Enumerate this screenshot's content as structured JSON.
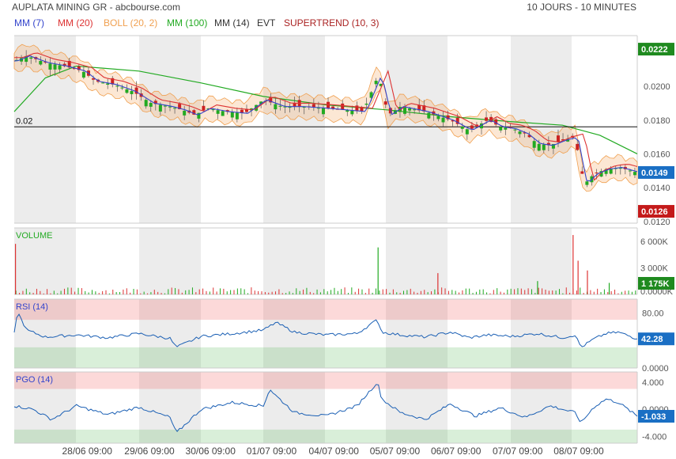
{
  "header": {
    "title": "AUPLATA MINING GR - abcbourse.com",
    "period": "10 JOURS - 10 MINUTES"
  },
  "legend": [
    {
      "label": "MM (7)",
      "color": "#3344cc"
    },
    {
      "label": "MM (20)",
      "color": "#dd3333"
    },
    {
      "label": "BOLL (20, 2)",
      "color": "#f0a050"
    },
    {
      "label": "MM (100)",
      "color": "#22aa22"
    },
    {
      "label": "MM (14)",
      "color": "#333333"
    },
    {
      "label": "EVT",
      "color": "#333333"
    },
    {
      "label": "SUPERTREND (10, 3)",
      "color": "#aa2222"
    }
  ],
  "chart_data": [
    {
      "type": "line",
      "panel": "price",
      "y_ticks": [
        "0.0200",
        "0.0180",
        "0.0160",
        "0.0140",
        "0.0120"
      ],
      "ylim": [
        0.0119,
        0.023
      ],
      "reference_line": {
        "value": 0.0176,
        "label": "0.02"
      },
      "price_badges": [
        {
          "text": "0.0222",
          "value": 0.0222,
          "color": "#1f8a1f"
        },
        {
          "text": "0.0149",
          "value": 0.0149,
          "color": "#1a6fc4"
        },
        {
          "text": "0.0126",
          "value": 0.0126,
          "color": "#c41a1a"
        }
      ],
      "close_series": {
        "x": [
          0,
          0.02,
          0.05,
          0.08,
          0.11,
          0.13,
          0.16,
          0.19,
          0.22,
          0.25,
          0.27,
          0.29,
          0.31,
          0.34,
          0.37,
          0.4,
          0.43,
          0.46,
          0.5,
          0.53,
          0.56,
          0.585,
          0.6,
          0.62,
          0.66,
          0.7,
          0.73,
          0.76,
          0.78,
          0.8,
          0.82,
          0.84,
          0.86,
          0.88,
          0.9,
          0.905,
          0.915,
          0.93,
          0.95,
          0.97,
          0.99,
          1.0
        ],
        "y": [
          0.0215,
          0.0218,
          0.0214,
          0.0212,
          0.0209,
          0.0203,
          0.0201,
          0.0197,
          0.019,
          0.0188,
          0.0186,
          0.0183,
          0.0187,
          0.0185,
          0.0184,
          0.0192,
          0.0188,
          0.0188,
          0.0187,
          0.0186,
          0.0185,
          0.0207,
          0.0183,
          0.0188,
          0.0185,
          0.018,
          0.0174,
          0.018,
          0.0176,
          0.0175,
          0.0172,
          0.0166,
          0.0165,
          0.0168,
          0.017,
          0.016,
          0.0142,
          0.0148,
          0.0151,
          0.0152,
          0.015,
          0.0149
        ]
      },
      "mm100_series": {
        "x": [
          0,
          0.05,
          0.1,
          0.2,
          0.3,
          0.4,
          0.5,
          0.6,
          0.7,
          0.8,
          0.88,
          0.94,
          1.0
        ],
        "y": [
          0.0185,
          0.0205,
          0.0212,
          0.0209,
          0.0202,
          0.0194,
          0.0189,
          0.0186,
          0.0182,
          0.0179,
          0.0177,
          0.0171,
          0.016
        ]
      }
    },
    {
      "type": "bar",
      "panel": "volume",
      "title": "VOLUME",
      "y_ticks": [
        "6 000K",
        "3 000K",
        "0.0000K"
      ],
      "ylim": [
        0,
        7500
      ],
      "last_value": "1 175K",
      "spikes": [
        {
          "x": 0.002,
          "value": 5700,
          "color": "#dd3333"
        },
        {
          "x": 0.584,
          "value": 5300,
          "color": "#22aa22"
        },
        {
          "x": 0.68,
          "value": 2400,
          "color": "#dd3333"
        },
        {
          "x": 0.897,
          "value": 6700,
          "color": "#dd3333"
        },
        {
          "x": 0.905,
          "value": 3800,
          "color": "#dd3333"
        },
        {
          "x": 0.92,
          "value": 2700,
          "color": "#dd3333"
        },
        {
          "x": 0.84,
          "value": 1500,
          "color": "#22aa22"
        },
        {
          "x": 0.955,
          "value": 1300,
          "color": "#22aa22"
        }
      ]
    },
    {
      "type": "line",
      "panel": "rsi",
      "title": "RSI (14)",
      "y_ticks": [
        "80.00",
        "0.0000"
      ],
      "ylim": [
        0,
        100
      ],
      "last_value": "42.28",
      "series": {
        "x": [
          0,
          0.005,
          0.02,
          0.05,
          0.1,
          0.15,
          0.2,
          0.25,
          0.26,
          0.3,
          0.35,
          0.4,
          0.42,
          0.45,
          0.5,
          0.55,
          0.583,
          0.59,
          0.62,
          0.66,
          0.7,
          0.73,
          0.76,
          0.8,
          0.84,
          0.88,
          0.9,
          0.91,
          0.93,
          0.95,
          0.97,
          1.0
        ],
        "y": [
          50,
          82,
          55,
          45,
          48,
          44,
          50,
          43,
          30,
          46,
          50,
          55,
          66,
          52,
          48,
          50,
          70,
          52,
          48,
          45,
          52,
          44,
          48,
          46,
          50,
          44,
          48,
          30,
          42,
          50,
          52,
          42.28
        ]
      }
    },
    {
      "type": "line",
      "panel": "pgo",
      "title": "PGO (14)",
      "y_ticks": [
        "4.000",
        "0.0000",
        "-4.000"
      ],
      "ylim": [
        -5,
        5.5
      ],
      "last_value": "-1.033",
      "series": {
        "x": [
          0,
          0.03,
          0.06,
          0.1,
          0.15,
          0.2,
          0.25,
          0.26,
          0.3,
          0.35,
          0.4,
          0.41,
          0.42,
          0.45,
          0.5,
          0.55,
          0.583,
          0.59,
          0.62,
          0.66,
          0.7,
          0.74,
          0.78,
          0.82,
          0.86,
          0.9,
          0.91,
          0.93,
          0.95,
          0.97,
          1.0
        ],
        "y": [
          0.5,
          0,
          -1.5,
          0.5,
          -0.8,
          0.3,
          -1.2,
          -3.5,
          0,
          1.0,
          0.5,
          3.0,
          2.0,
          -0.5,
          -1,
          0.5,
          4.0,
          1.5,
          -0.5,
          -1.5,
          0.8,
          -1,
          0.2,
          -1.2,
          0.5,
          -0.5,
          -2,
          0.3,
          1.5,
          1.0,
          -1.033
        ]
      }
    },
    {
      "type": "axis",
      "panel": "time-axis",
      "x_tick_labels": [
        "28/06 09:00",
        "29/06 09:00",
        "30/06 09:00",
        "01/07 09:00",
        "04/07 09:00",
        "05/07 09:00",
        "06/07 09:00",
        "07/07 09:00",
        "08/07 09:00"
      ],
      "x_tick_positions": [
        0.117,
        0.217,
        0.315,
        0.413,
        0.513,
        0.611,
        0.709,
        0.808,
        0.906
      ]
    }
  ]
}
